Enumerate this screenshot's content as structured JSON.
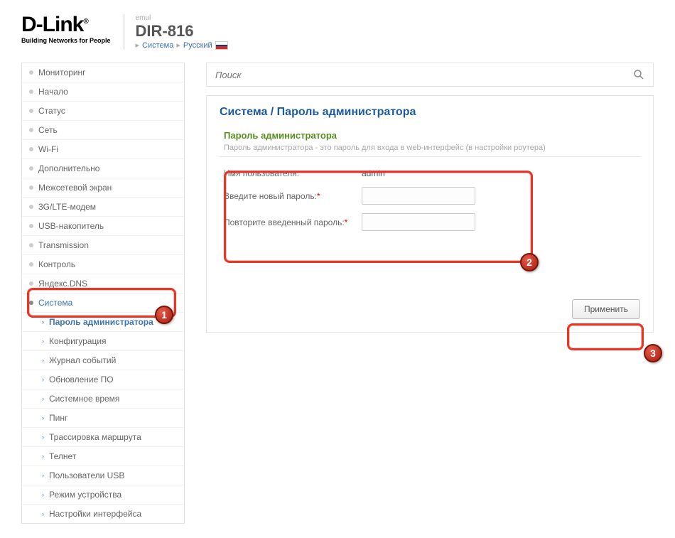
{
  "header": {
    "logo": "D-Link",
    "slogan": "Building Networks for People",
    "emul": "emul",
    "model": "DIR-816",
    "bc_system": "Система",
    "bc_lang": "Русский"
  },
  "sidebar": {
    "items": [
      {
        "label": "Мониторинг"
      },
      {
        "label": "Начало"
      },
      {
        "label": "Статус"
      },
      {
        "label": "Сеть"
      },
      {
        "label": "Wi-Fi"
      },
      {
        "label": "Дополнительно"
      },
      {
        "label": "Межсетевой экран"
      },
      {
        "label": "3G/LTE-модем"
      },
      {
        "label": "USB-накопитель"
      },
      {
        "label": "Transmission"
      },
      {
        "label": "Контроль"
      },
      {
        "label": "Яндекс.DNS"
      }
    ],
    "expanded_label": "Система",
    "sub": [
      {
        "label": "Пароль администратора",
        "active": true
      },
      {
        "label": "Конфигурация"
      },
      {
        "label": "Журнал событий"
      },
      {
        "label": "Обновление ПО"
      },
      {
        "label": "Системное время"
      },
      {
        "label": "Пинг"
      },
      {
        "label": "Трассировка маршрута"
      },
      {
        "label": "Телнет"
      },
      {
        "label": "Пользователи USB"
      },
      {
        "label": "Режим устройства"
      },
      {
        "label": "Настройки интерфейса"
      }
    ]
  },
  "search": {
    "placeholder": "Поиск"
  },
  "panel": {
    "crumb": "Система /  Пароль администратора",
    "section_title": "Пароль администратора",
    "section_desc": "Пароль администратора - это пароль для входа в web-интерфейс (в настройки роутера)",
    "user_label": "Имя пользователя:",
    "user_value": "admin",
    "new_pw_label": "Введите новый пароль:",
    "repeat_label": "Повторите введенный пароль:",
    "apply": "Применить"
  },
  "badges": {
    "b1": "1",
    "b2": "2",
    "b3": "3"
  }
}
